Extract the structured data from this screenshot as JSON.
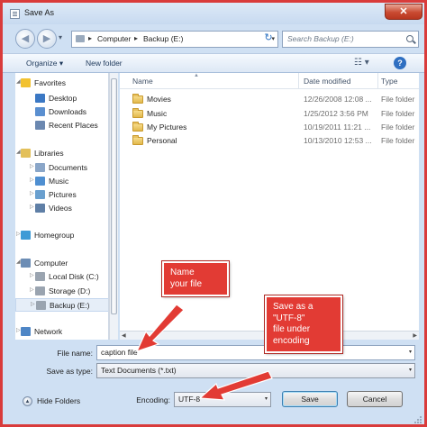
{
  "window": {
    "title": "Save As",
    "close_glyph": "✕"
  },
  "nav": {
    "back_glyph": "◀",
    "forward_glyph": "▶",
    "address": {
      "segments": [
        "Computer",
        "Backup (E:)"
      ],
      "separator": "▸"
    },
    "refresh_glyph": "↻",
    "search_placeholder": "Search Backup (E:)"
  },
  "toolbar": {
    "organize": "Organize ▾",
    "new_folder": "New folder",
    "views_glyph": "☷ ▾",
    "help_glyph": "?"
  },
  "sidebar": {
    "items": [
      {
        "label": "Favorites",
        "expander": "◢",
        "icon": "star-icon",
        "icon_color": "#f2c230",
        "level": 0
      },
      {
        "label": "Desktop",
        "expander": "",
        "icon": "desktop-icon",
        "icon_color": "#3b78c4",
        "level": 1
      },
      {
        "label": "Downloads",
        "expander": "",
        "icon": "downloads-icon",
        "icon_color": "#5a8fd0",
        "level": 1
      },
      {
        "label": "Recent Places",
        "expander": "",
        "icon": "recent-places-icon",
        "icon_color": "#6b88b0",
        "level": 1
      },
      {
        "label": "Libraries",
        "expander": "◢",
        "icon": "libraries-icon",
        "icon_color": "#e3c05a",
        "level": 0
      },
      {
        "label": "Documents",
        "expander": "▷",
        "icon": "documents-icon",
        "icon_color": "#8aa6c8",
        "level": 1
      },
      {
        "label": "Music",
        "expander": "▷",
        "icon": "music-icon",
        "icon_color": "#4f8fd1",
        "level": 1
      },
      {
        "label": "Pictures",
        "expander": "▷",
        "icon": "pictures-icon",
        "icon_color": "#6aa0cf",
        "level": 1
      },
      {
        "label": "Videos",
        "expander": "▷",
        "icon": "videos-icon",
        "icon_color": "#5f7fa6",
        "level": 1
      },
      {
        "label": "Homegroup",
        "expander": "▷",
        "icon": "homegroup-icon",
        "icon_color": "#3e9bd6",
        "level": 0
      },
      {
        "label": "Computer",
        "expander": "◢",
        "icon": "computer-icon",
        "icon_color": "#6c8db5",
        "level": 0
      },
      {
        "label": "Local Disk (C:)",
        "expander": "▷",
        "icon": "local-disk-icon",
        "icon_color": "#9aa4b0",
        "level": 1
      },
      {
        "label": "Storage (D:)",
        "expander": "▷",
        "icon": "storage-drive-icon",
        "icon_color": "#9aa4b0",
        "level": 1
      },
      {
        "label": "Backup (E:)",
        "expander": "▷",
        "icon": "backup-drive-icon",
        "icon_color": "#9aa4b0",
        "level": 1,
        "selected": true
      },
      {
        "label": "Network",
        "expander": "▷",
        "icon": "network-icon",
        "icon_color": "#4e86c6",
        "level": 0
      }
    ]
  },
  "files": {
    "columns": {
      "name": "Name",
      "date": "Date modified",
      "type": "Type"
    },
    "sort_glyph": "▲",
    "rows": [
      {
        "name": "Movies",
        "date": "12/26/2008 12:08 ...",
        "type": "File folder"
      },
      {
        "name": "Music",
        "date": "1/25/2012 3:56 PM",
        "type": "File folder"
      },
      {
        "name": "My Pictures",
        "date": "10/19/2011 11:21 ...",
        "type": "File folder"
      },
      {
        "name": "Personal",
        "date": "10/13/2010 12:53 ...",
        "type": "File folder"
      }
    ]
  },
  "form": {
    "file_name_label": "File name:",
    "file_name_value": "caption file",
    "save_type_label": "Save as type:",
    "save_type_value": "Text Documents (*.txt)",
    "encoding_label": "Encoding:",
    "encoding_value": "UTF-8",
    "hide_folders": "Hide Folders",
    "save_button": "Save",
    "cancel_button": "Cancel",
    "drop_glyph": "▾"
  },
  "annotations": {
    "name_callout": "Name\nyour file",
    "encoding_callout": "Save as a\n\"UTF-8\"\nfile under\nencoding",
    "color": "#e23b34"
  }
}
